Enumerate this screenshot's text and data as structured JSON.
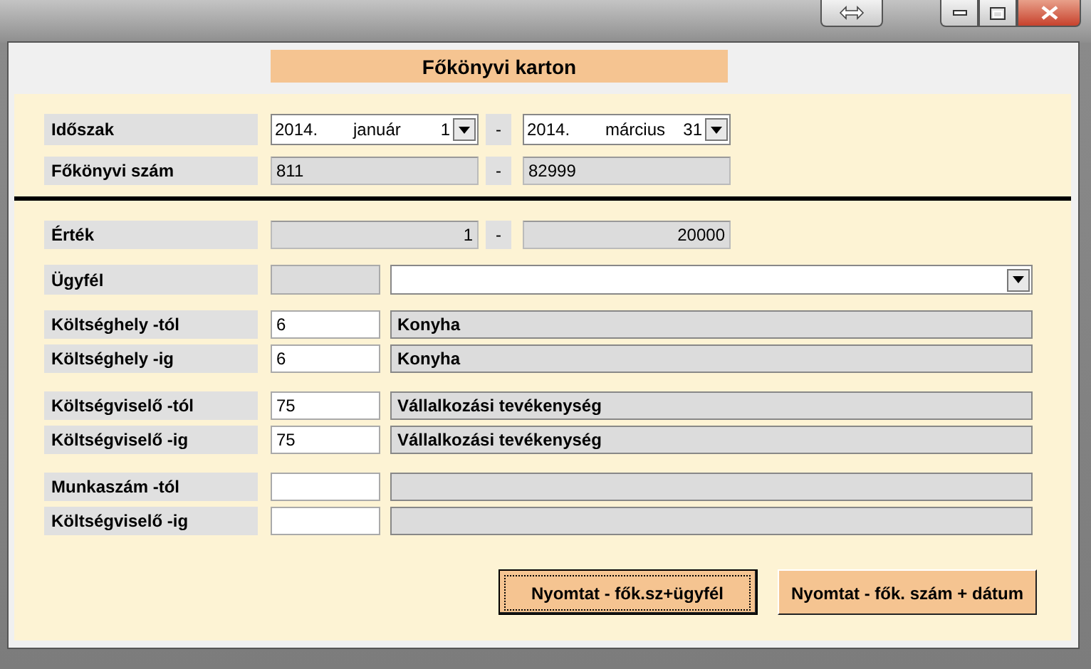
{
  "window": {
    "title": "Főkönyvi karton"
  },
  "top_rows": [
    {
      "kind": "date_range",
      "label": "Időszak",
      "separator": "-",
      "from": {
        "year": "2014.",
        "month": "január",
        "day": "1"
      },
      "to": {
        "year": "2014.",
        "month": "március",
        "day": "31"
      }
    },
    {
      "kind": "text_range",
      "label": "Főkönyvi szám",
      "separator": "-",
      "from": "811",
      "to": "82999"
    }
  ],
  "sections": [
    [
      {
        "kind": "number_range",
        "label": "Érték",
        "separator": "-",
        "from": "1",
        "to": "20000"
      },
      {
        "kind": "client",
        "label": "Ügyfél"
      }
    ],
    [
      {
        "kind": "code_name",
        "label": "Költséghely -tól",
        "code": "6",
        "name": "Konyha"
      },
      {
        "kind": "code_name",
        "label": "Költséghely -ig",
        "code": "6",
        "name": "Konyha"
      }
    ],
    [
      {
        "kind": "code_name",
        "label": "Költségviselő -tól",
        "code": "75",
        "name": "Vállalkozási tevékenység"
      },
      {
        "kind": "code_name",
        "label": "Költségviselő -ig",
        "code": "75",
        "name": "Vállalkozási tevékenység"
      }
    ],
    [
      {
        "kind": "code_name",
        "label": "Munkaszám -tól"
      },
      {
        "kind": "code_name",
        "label": "Költségviselő -ig"
      }
    ]
  ],
  "buttons": [
    {
      "label": "Nyomtat - fők.sz+ügyfél",
      "focused": true
    },
    {
      "label": "Nyomtat - fők. szám + dátum",
      "focused": false
    }
  ]
}
